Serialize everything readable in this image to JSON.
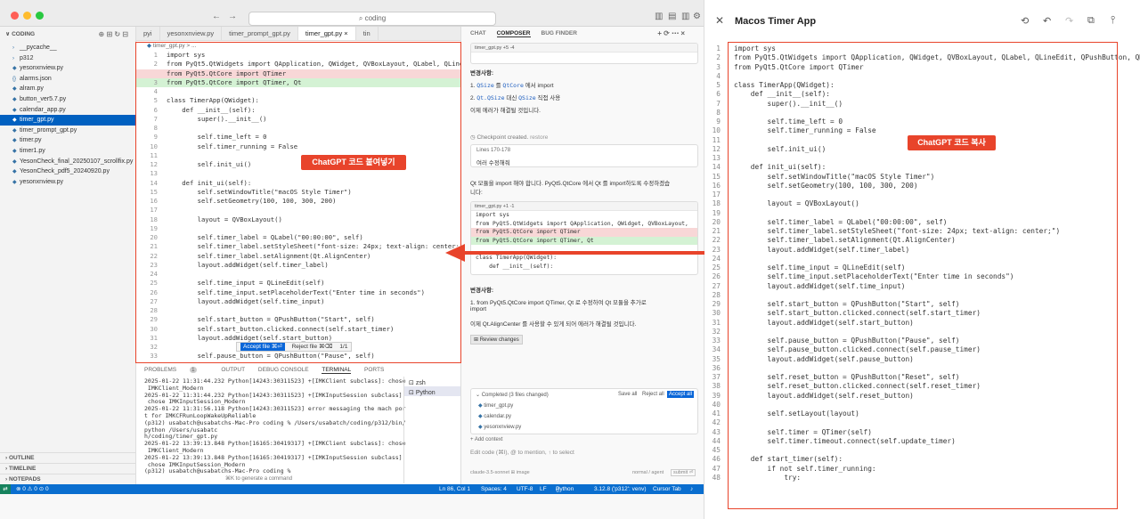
{
  "window": {
    "search": "coding"
  },
  "sidebar": {
    "title": "CODING",
    "items": [
      {
        "label": "__pycache__",
        "kind": "folder",
        "active": false
      },
      {
        "label": "p312",
        "kind": "folder",
        "active": false
      },
      {
        "label": "yesonxnview.py",
        "kind": "py",
        "active": false
      },
      {
        "label": "alarms.json",
        "kind": "json",
        "active": false
      },
      {
        "label": "alram.py",
        "kind": "py",
        "active": false
      },
      {
        "label": "button_ver5.7.py",
        "kind": "py",
        "active": false
      },
      {
        "label": "calendar_app.py",
        "kind": "py",
        "active": false
      },
      {
        "label": "timer_gpt.py",
        "kind": "py",
        "active": true
      },
      {
        "label": "timer_prompt_gpt.py",
        "kind": "py",
        "active": false
      },
      {
        "label": "timer.py",
        "kind": "py",
        "active": false
      },
      {
        "label": "timer1.py",
        "kind": "py",
        "active": false
      },
      {
        "label": "YesonCheck_final_20250107_scrollfix.py",
        "kind": "py",
        "active": false
      },
      {
        "label": "YesonCheck_pdf5_20240920.py",
        "kind": "py",
        "active": false
      },
      {
        "label": "yesonxnview.py",
        "kind": "py",
        "active": false
      }
    ],
    "footer": [
      "OUTLINE",
      "TIMELINE",
      "NOTEPADS"
    ]
  },
  "tabs": [
    "pyi",
    "yesonxnview.py",
    "timer_prompt_gpt.py",
    "timer_gpt.py",
    "tin"
  ],
  "breadcrumb": "timer_gpt.py > ...",
  "editor_lines": [
    {
      "n": "1",
      "t": "import sys",
      "k": ""
    },
    {
      "n": "2",
      "t": "from PyQt5.QtWidgets import QApplication, QWidget, QVBoxLayout, QLabel, QLineEdit, QPu",
      "k": ""
    },
    {
      "n": "",
      "t": "from PyQt5.QtCore import QTimer",
      "k": "del"
    },
    {
      "n": "3",
      "t": "from PyQt5.QtCore import QTimer, Qt",
      "k": "add"
    },
    {
      "n": "4",
      "t": "",
      "k": ""
    },
    {
      "n": "5",
      "t": "class TimerApp(QWidget):",
      "k": ""
    },
    {
      "n": "6",
      "t": "    def __init__(self):",
      "k": ""
    },
    {
      "n": "7",
      "t": "        super().__init__()",
      "k": ""
    },
    {
      "n": "8",
      "t": "",
      "k": ""
    },
    {
      "n": "9",
      "t": "        self.time_left = 0",
      "k": ""
    },
    {
      "n": "10",
      "t": "        self.timer_running = False",
      "k": ""
    },
    {
      "n": "11",
      "t": "",
      "k": ""
    },
    {
      "n": "12",
      "t": "        self.init_ui()",
      "k": ""
    },
    {
      "n": "13",
      "t": "",
      "k": ""
    },
    {
      "n": "14",
      "t": "    def init_ui(self):",
      "k": ""
    },
    {
      "n": "15",
      "t": "        self.setWindowTitle(\"macOS Style Timer\")",
      "k": ""
    },
    {
      "n": "16",
      "t": "        self.setGeometry(100, 100, 300, 200)",
      "k": ""
    },
    {
      "n": "17",
      "t": "",
      "k": ""
    },
    {
      "n": "18",
      "t": "        layout = QVBoxLayout()",
      "k": ""
    },
    {
      "n": "19",
      "t": "",
      "k": ""
    },
    {
      "n": "20",
      "t": "        self.timer_label = QLabel(\"00:00:00\", self)",
      "k": ""
    },
    {
      "n": "21",
      "t": "        self.timer_label.setStyleSheet(\"font-size: 24px; text-align: center;\")",
      "k": ""
    },
    {
      "n": "22",
      "t": "        self.timer_label.setAlignment(Qt.AlignCenter)",
      "k": ""
    },
    {
      "n": "23",
      "t": "        layout.addWidget(self.timer_label)",
      "k": ""
    },
    {
      "n": "24",
      "t": "",
      "k": ""
    },
    {
      "n": "25",
      "t": "        self.time_input = QLineEdit(self)",
      "k": ""
    },
    {
      "n": "26",
      "t": "        self.time_input.setPlaceholderText(\"Enter time in seconds\")",
      "k": ""
    },
    {
      "n": "27",
      "t": "        layout.addWidget(self.time_input)",
      "k": ""
    },
    {
      "n": "28",
      "t": "",
      "k": ""
    },
    {
      "n": "29",
      "t": "        self.start_button = QPushButton(\"Start\", self)",
      "k": ""
    },
    {
      "n": "30",
      "t": "        self.start_button.clicked.connect(self.start_timer)",
      "k": ""
    },
    {
      "n": "31",
      "t": "        layout.addWidget(self.start_button)",
      "k": ""
    },
    {
      "n": "32",
      "t": "",
      "k": ""
    },
    {
      "n": "33",
      "t": "        self.pause_button = QPushButton(\"Pause\", self)",
      "k": ""
    },
    {
      "n": "34",
      "t": "        self.paus",
      "k": ""
    },
    {
      "n": "35",
      "t": "        layout.addWidget(self.pause_button)",
      "k": ""
    }
  ],
  "accept_bar": {
    "accept": "Accept file ⌘⏎",
    "reject": "Reject file ⌘⌫",
    "count": "1/1"
  },
  "panel": {
    "tabs": [
      "PROBLEMS",
      "OUTPUT",
      "DEBUG CONSOLE",
      "TERMINAL",
      "PORTS"
    ],
    "problems_count": "1",
    "terminal": "2025-01-22 11:31:44.232 Python[14243:30311523] +[IMKClient subclass]: chose\n IMKClient_Modern\n2025-01-22 11:31:44.232 Python[14243:30311523] +[IMKInputSession subclass]:\n chose IMKInputSession_Modern\n2025-01-22 11:31:56.118 Python[14243:30311523] error messaging the mach por\nt for IMKCFRunLoopWakeUpReliable\n(p312) usabatch@usabatchs-Mac-Pro coding % /Users/usabatch/coding/p312/bin/\npython /Users/usabatc\nh/coding/timer_gpt.py\n2025-01-22 13:39:13.848 Python[16165:30419317] +[IMKClient subclass]: chose\n IMKClient_Modern\n2025-01-22 13:39:13.848 Python[16165:30419317] +[IMKInputSession subclass]:\n chose IMKInputSession_Modern\n(p312) usabatch@usabatchs-Mac-Pro coding % ",
    "generate_hint": "⌘K to generate a command",
    "terminals": [
      "zsh",
      "Python"
    ]
  },
  "ai": {
    "tabs": [
      "CHAT",
      "COMPOSER",
      "BUG FINDER"
    ],
    "top_file": "timer_gpt.py +5 -4",
    "sec1_title": "변경사항:",
    "li1_pre": "1. ",
    "li1_code1": "QSize",
    "li1_mid": " 를 ",
    "li1_code2": "QtCore",
    "li1_post": " 에서 import",
    "li2_pre": "2. ",
    "li2_code1": "Qt.QSize",
    "li2_mid": " 대신 ",
    "li2_code2": "QSize",
    "li2_post": " 직접 사용",
    "resolved": "이제 에러가 해결될 것입니다.",
    "checkpoint": "Checkpoint created.",
    "restore": "restore",
    "lines_ref": "Lines 170-178",
    "lines_note": "여러 수정해줘",
    "request_line1": "Qt 모듈을 import 해야 합니다. PyQt5.QtCore 에서 Qt 를 import하도록 수정하겠습",
    "request_line2": "니다:",
    "code_head": "timer_gpt.py +1 -1",
    "code_lines": [
      {
        "t": "import sys",
        "k": ""
      },
      {
        "t": "from PyQt5.QtWidgets import QApplication, QWidget, QVBoxLayout,",
        "k": ""
      },
      {
        "t": "from PyQt5.QtCore import QTimer",
        "k": "del"
      },
      {
        "t": "from PyQt5.QtCore import QTimer, Qt",
        "k": "add"
      },
      {
        "t": "",
        "k": ""
      },
      {
        "t": "class TimerApp(QWidget):",
        "k": ""
      },
      {
        "t": "    def __init__(self):",
        "k": ""
      }
    ],
    "sec2_title": "변경사항:",
    "change1_a": "1. from PyQt5.QtCore import QTimer, Qt 로 수정하여 Qt 모듈을 추가로",
    "change1_b": "import",
    "change2": "이제 Qt.AlignCenter 를 사용할 수 있게 되어 에러가 해결될 것입니다.",
    "review": "Review changes",
    "completed": "Completed (3 files changed)",
    "save_all": "Save all",
    "reject_all": "Reject all",
    "accept_all": "Accept all",
    "changed_files": [
      "timer_gpt.py",
      "calendar.py",
      "yesonxnview.py"
    ],
    "add_context": "+ Add context",
    "input_placeholder": "Edit code (⌘I), @ to mention, ↑ to select",
    "model": "claude-3.5-sonnet",
    "image": "image",
    "mode": "normal / agent",
    "submit": "submit ⏎"
  },
  "status": {
    "branch": "⊗ 0 ⚠ 0 ⊙ 0",
    "position": "Ln 86, Col 1",
    "spaces": "Spaces: 4",
    "encoding": "UTF-8",
    "eol": "LF",
    "lang": "Python",
    "interp": "3.12.8 ('p312': venv)",
    "cursor_tab": "Cursor Tab"
  },
  "callouts": {
    "paste": "ChatGPT 코드 붙여넣기",
    "copy": "ChatGPT 코드 복사"
  },
  "right_panel": {
    "title": "Macos Timer App",
    "lines": [
      "import sys",
      "from PyQt5.QtWidgets import QApplication, QWidget, QVBoxLayout, QLabel, QLineEdit, QPushButton, QMe",
      "from PyQt5.QtCore import QTimer",
      "",
      "class TimerApp(QWidget):",
      "    def __init__(self):",
      "        super().__init__()",
      "",
      "        self.time_left = 0",
      "        self.timer_running = False",
      "",
      "        self.init_ui()",
      "",
      "    def init_ui(self):",
      "        self.setWindowTitle(\"macOS Style Timer\")",
      "        self.setGeometry(100, 100, 300, 200)",
      "",
      "        layout = QVBoxLayout()",
      "",
      "        self.timer_label = QLabel(\"00:00:00\", self)",
      "        self.timer_label.setStyleSheet(\"font-size: 24px; text-align: center;\")",
      "        self.timer_label.setAlignment(Qt.AlignCenter)",
      "        layout.addWidget(self.timer_label)",
      "",
      "        self.time_input = QLineEdit(self)",
      "        self.time_input.setPlaceholderText(\"Enter time in seconds\")",
      "        layout.addWidget(self.time_input)",
      "",
      "        self.start_button = QPushButton(\"Start\", self)",
      "        self.start_button.clicked.connect(self.start_timer)",
      "        layout.addWidget(self.start_button)",
      "",
      "        self.pause_button = QPushButton(\"Pause\", self)",
      "        self.pause_button.clicked.connect(self.pause_timer)",
      "        layout.addWidget(self.pause_button)",
      "",
      "        self.reset_button = QPushButton(\"Reset\", self)",
      "        self.reset_button.clicked.connect(self.reset_timer)",
      "        layout.addWidget(self.reset_button)",
      "",
      "        self.setLayout(layout)",
      "",
      "        self.timer = QTimer(self)",
      "        self.timer.timeout.connect(self.update_timer)",
      "",
      "    def start_timer(self):",
      "        if not self.timer_running:",
      "            try:"
    ]
  },
  "colors": {
    "accent": "#0a6ecf",
    "callout": "#e8442b",
    "active_item": "#0060c0"
  }
}
